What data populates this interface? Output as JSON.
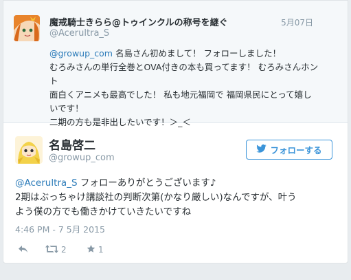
{
  "parent_tweet": {
    "display_name": "魔戒騎士きらら@トゥインクルの称号を継ぐ",
    "handle": "@Acerultra_S",
    "date": "5月07日",
    "mention": "@growup_com",
    "lines": [
      " 名島さん初めまして！ フォローしました！",
      "むろみさんの単行全巻とOVA付きの本も買ってます！ むろみさんホント",
      "面白くアニメも最高でした！ 私も地元福岡で 福岡県民にとって嬉し",
      "いです！",
      "二期の方も是非出したいです！＞_＜"
    ]
  },
  "tweet": {
    "display_name": "名島啓二",
    "handle": "@growup_com",
    "follow_label": "フォローする",
    "mention": "@Acerultra_S",
    "line1_rest": " フォローありがとうございます♪",
    "line2": "2期はぶっちゃけ講談社の判断次第(かなり厳しい)なんですが、叶う",
    "line3": "よう僕の方でも働きかけていきたいですね",
    "timestamp": "4:46 PM - 7 5月 2015",
    "retweet_count": "2",
    "favorite_count": "1"
  },
  "colors": {
    "link": "#2b7bb9",
    "meta": "#8899a6",
    "follow": "#3b94d9"
  },
  "icons": [
    "twitter-bird-icon",
    "reply-icon",
    "retweet-icon",
    "favorite-star-icon"
  ]
}
